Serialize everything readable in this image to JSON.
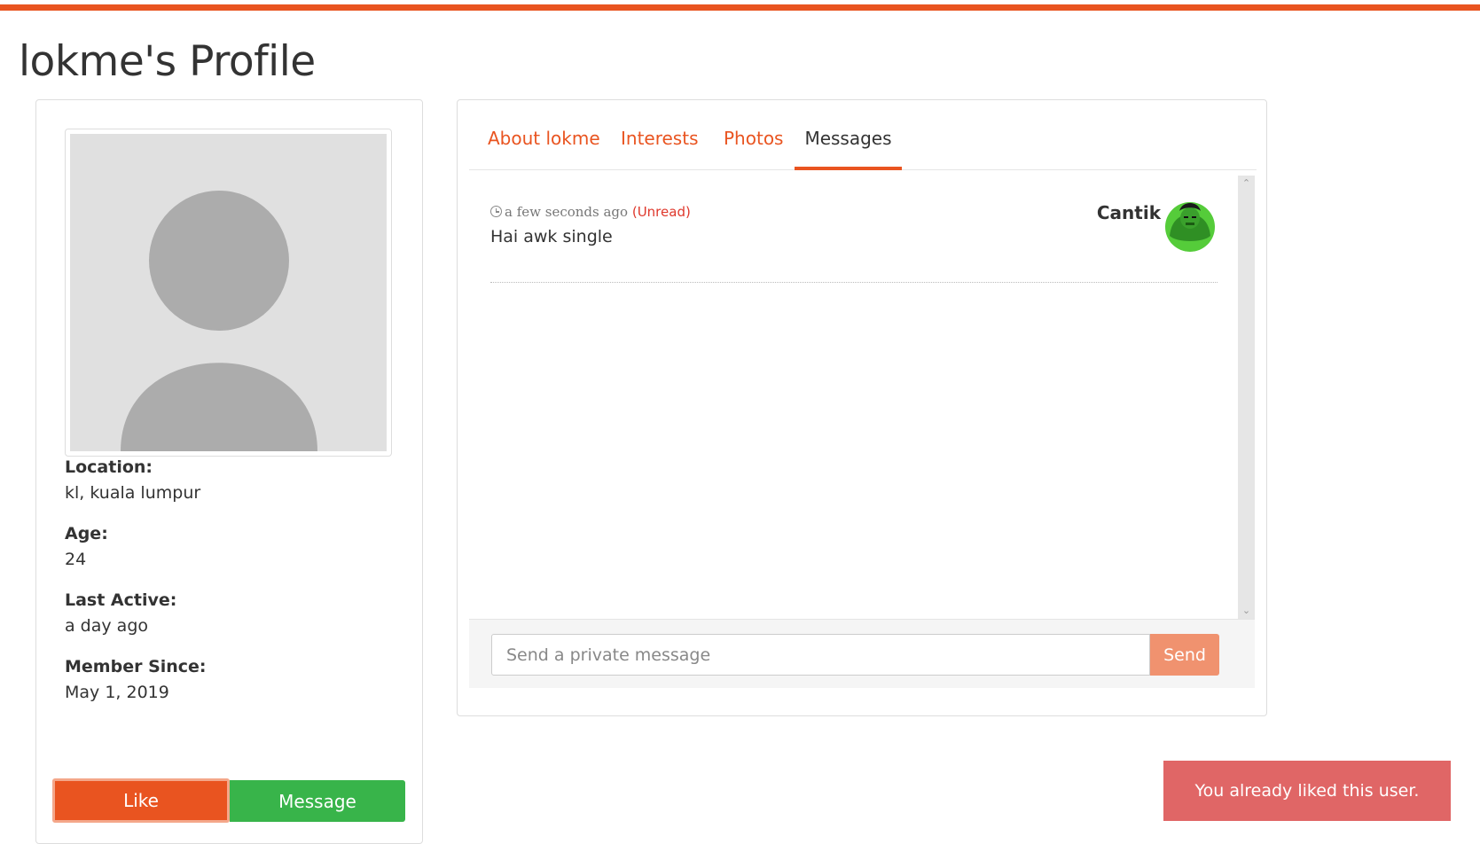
{
  "page": {
    "title": "lokme's Profile"
  },
  "profile": {
    "photo_icon": "default-avatar-placeholder",
    "fields": [
      {
        "label": "Location:",
        "value": "kl, kuala lumpur"
      },
      {
        "label": "Age:",
        "value": "24"
      },
      {
        "label": "Last Active:",
        "value": "a day ago"
      },
      {
        "label": "Member Since:",
        "value": "May 1, 2019"
      }
    ],
    "like_label": "Like",
    "message_label": "Message"
  },
  "tabs": [
    {
      "label": "About lokme",
      "active": false
    },
    {
      "label": "Interests",
      "active": false
    },
    {
      "label": "Photos",
      "active": false
    },
    {
      "label": "Messages",
      "active": true
    }
  ],
  "messages": [
    {
      "time": "a few seconds ago",
      "status": "(Unread)",
      "text": "Hai awk single",
      "sender": "Cantik",
      "sender_avatar_icon": "hulk-avatar"
    }
  ],
  "compose": {
    "placeholder": "Send a private message",
    "value": "",
    "send_label": "Send"
  },
  "toast": {
    "text": "You already liked this user."
  },
  "colors": {
    "accent": "#e95420",
    "success": "#38b44a",
    "danger_toast": "#e06666",
    "unread": "#df382c"
  }
}
